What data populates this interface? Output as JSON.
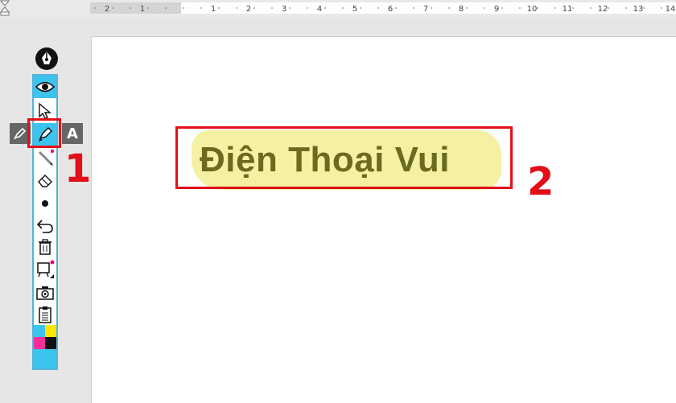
{
  "ruler": {
    "labels": [
      "2",
      "1",
      "1",
      "2",
      "3",
      "4",
      "5",
      "6",
      "7",
      "8",
      "9",
      "10",
      "11",
      "12",
      "13",
      "14"
    ]
  },
  "toolbar": {
    "tools": [
      {
        "name": "eye",
        "icon": "eye-icon"
      },
      {
        "name": "select",
        "icon": "arrow-cursor-icon"
      },
      {
        "name": "highlighter",
        "icon": "highlighter-icon"
      },
      {
        "name": "pen",
        "icon": "pencil-icon"
      },
      {
        "name": "eraser",
        "icon": "eraser-icon"
      },
      {
        "name": "dot",
        "icon": "dot-icon"
      },
      {
        "name": "undo",
        "icon": "undo-icon"
      },
      {
        "name": "delete",
        "icon": "trash-icon"
      },
      {
        "name": "board",
        "icon": "whiteboard-icon"
      },
      {
        "name": "camera",
        "icon": "camera-icon"
      },
      {
        "name": "clipboard",
        "icon": "clipboard-icon"
      }
    ],
    "side_right_label": "A",
    "palette_colors": [
      "#3cc4ef",
      "#ffe600",
      "#ff2d9a",
      "#111111"
    ],
    "accent": "#3cc4ef"
  },
  "annotations": {
    "label_1": "1",
    "label_2": "2",
    "color": "#e30e18"
  },
  "document": {
    "highlighted_text": "Điện Thoại Vui",
    "highlight_color": "#f4f09e",
    "text_color": "#6b6a1e"
  }
}
